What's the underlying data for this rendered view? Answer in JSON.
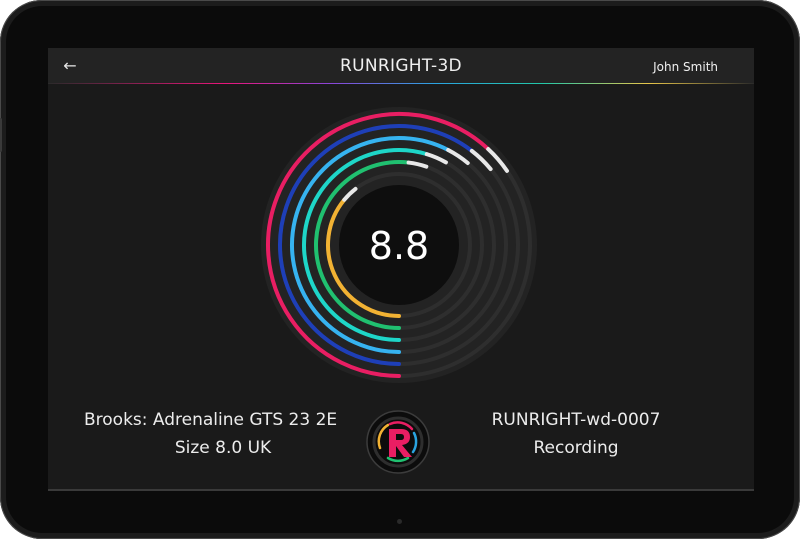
{
  "app": {
    "title": "RUNRIGHT-3D",
    "user_name": "John Smith"
  },
  "gauge": {
    "value": "8.8",
    "rings": [
      {
        "color": "#e91e63",
        "level": 0.86
      },
      {
        "color": "#1e3fb8",
        "level": 0.84
      },
      {
        "color": "#36b3f0",
        "level": 0.8
      },
      {
        "color": "#1ed6c8",
        "level": 0.76
      },
      {
        "color": "#20c070",
        "level": 0.72
      },
      {
        "color": "#f2b233",
        "level": 0.5
      }
    ]
  },
  "shoe": {
    "model": "Brooks: Adrenaline GTS 23 2E",
    "size": "Size 8.0 UK"
  },
  "device": {
    "id": "RUNRIGHT-wd-0007",
    "status": "Recording"
  },
  "logo": {
    "letter": "R"
  }
}
